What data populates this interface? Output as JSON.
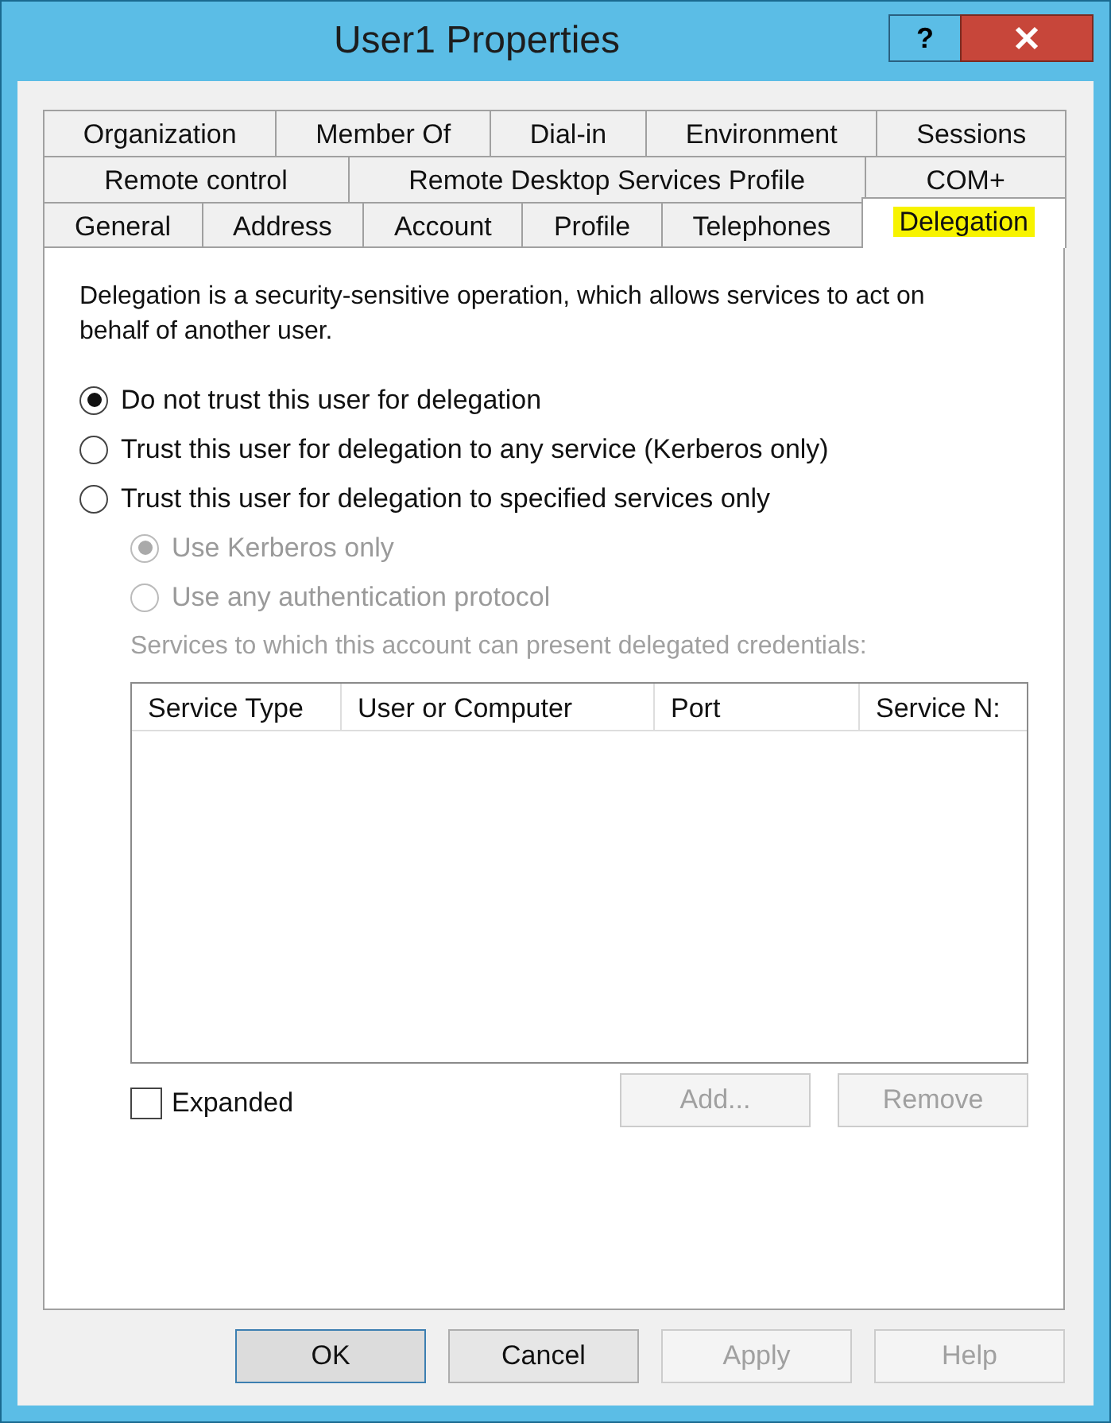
{
  "window": {
    "title": "User1 Properties",
    "help_button": "?"
  },
  "tab_rows": [
    [
      {
        "label": "Organization",
        "selected": false,
        "highlighted": false
      },
      {
        "label": "Member Of",
        "selected": false,
        "highlighted": false
      },
      {
        "label": "Dial-in",
        "selected": false,
        "highlighted": false
      },
      {
        "label": "Environment",
        "selected": false,
        "highlighted": false
      },
      {
        "label": "Sessions",
        "selected": false,
        "highlighted": false
      }
    ],
    [
      {
        "label": "Remote control",
        "selected": false,
        "highlighted": false
      },
      {
        "label": "Remote Desktop Services Profile",
        "selected": false,
        "highlighted": false
      },
      {
        "label": "COM+",
        "selected": false,
        "highlighted": false
      }
    ],
    [
      {
        "label": "General",
        "selected": false,
        "highlighted": false
      },
      {
        "label": "Address",
        "selected": false,
        "highlighted": false
      },
      {
        "label": "Account",
        "selected": false,
        "highlighted": false
      },
      {
        "label": "Profile",
        "selected": false,
        "highlighted": false
      },
      {
        "label": "Telephones",
        "selected": false,
        "highlighted": false
      },
      {
        "label": "Delegation",
        "selected": true,
        "highlighted": true
      }
    ]
  ],
  "description": "Delegation is a security-sensitive operation, which allows services to act on behalf of another user.",
  "options": [
    {
      "label": "Do not trust this user for delegation",
      "selected": true,
      "disabled": false
    },
    {
      "label": "Trust this user for delegation to any service (Kerberos only)",
      "selected": false,
      "disabled": false
    },
    {
      "label": "Trust this user for delegation to specified services only",
      "selected": false,
      "disabled": false,
      "children": [
        {
          "label": "Use Kerberos only",
          "selected": true,
          "disabled": true
        },
        {
          "label": "Use any authentication protocol",
          "selected": false,
          "disabled": true
        }
      ]
    }
  ],
  "services_label": {
    "text": "Services to which this account can present delegated credentials:",
    "disabled": true
  },
  "services_table": {
    "columns": [
      "Service Type",
      "User or Computer",
      "Port",
      "Service N:"
    ]
  },
  "expanded_checkbox": {
    "label": "Expanded",
    "checked": false
  },
  "list_buttons": [
    {
      "label": "Add...",
      "disabled": true
    },
    {
      "label": "Remove",
      "disabled": true
    }
  ],
  "dialog_buttons": [
    {
      "label": "OK",
      "disabled": false,
      "default": true
    },
    {
      "label": "Cancel",
      "disabled": false,
      "default": false
    },
    {
      "label": "Apply",
      "disabled": true,
      "default": false
    },
    {
      "label": "Help",
      "disabled": true,
      "default": false
    }
  ]
}
